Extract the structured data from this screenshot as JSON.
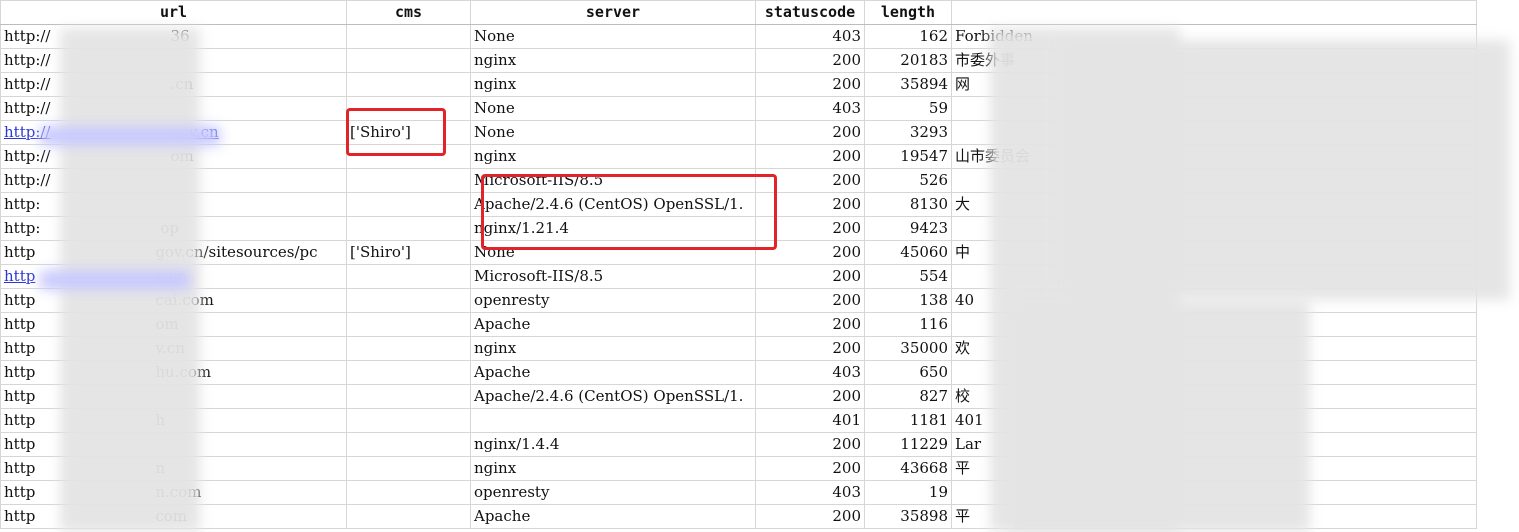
{
  "sheet": {
    "columns": [
      "url",
      "cms",
      "server",
      "statuscode",
      "length",
      ""
    ],
    "rows": [
      {
        "url": "http://",
        "url_tail": "36",
        "cms": "",
        "server": "None",
        "status": "403",
        "length": "162",
        "title": "Forbidden",
        "link": false
      },
      {
        "url": "http://",
        "url_tail": "",
        "cms": "",
        "server": "nginx",
        "status": "200",
        "length": "20183",
        "title": "市委外事",
        "link": false
      },
      {
        "url": "http://",
        "url_tail": ".cn",
        "cms": "",
        "server": "nginx",
        "status": "200",
        "length": "35894",
        "title": "网",
        "link": false
      },
      {
        "url": "http://",
        "url_tail": "",
        "cms": "",
        "server": "None",
        "status": "403",
        "length": "59",
        "title": "",
        "link": false
      },
      {
        "url": "http://",
        "url_tail": "gov.cn",
        "cms": "['Shiro']",
        "server": "None",
        "status": "200",
        "length": "3293",
        "title": "",
        "link": true
      },
      {
        "url": "http://",
        "url_tail": "om",
        "cms": "",
        "server": "nginx",
        "status": "200",
        "length": "19547",
        "title": "山市委员会",
        "link": false
      },
      {
        "url": "http://",
        "url_tail": "",
        "cms": "",
        "server": "Microsoft-IIS/8.5",
        "status": "200",
        "length": "526",
        "title": "",
        "link": false
      },
      {
        "url": "http:",
        "url_tail": "",
        "cms": "",
        "server": "Apache/2.4.6 (CentOS) OpenSSL/1.",
        "status": "200",
        "length": "8130",
        "title": "大",
        "link": false
      },
      {
        "url": "http:",
        "url_tail": "op",
        "cms": "",
        "server": "nginx/1.21.4",
        "status": "200",
        "length": "9423",
        "title": "",
        "link": false
      },
      {
        "url": "http",
        "url_tail": "gov.cn/sitesources/pc",
        "cms": "['Shiro']",
        "server": "None",
        "status": "200",
        "length": "45060",
        "title": "中",
        "link": false
      },
      {
        "url": "http",
        "url_tail": "com",
        "cms": "",
        "server": "Microsoft-IIS/8.5",
        "status": "200",
        "length": "554",
        "title": "",
        "link": true
      },
      {
        "url": "http",
        "url_tail": "cai.com",
        "cms": "",
        "server": "openresty",
        "status": "200",
        "length": "138",
        "title": "40",
        "link": false
      },
      {
        "url": "http",
        "url_tail": "om",
        "cms": "",
        "server": "Apache",
        "status": "200",
        "length": "116",
        "title": "",
        "link": false
      },
      {
        "url": "http",
        "url_tail": "v.cn",
        "cms": "",
        "server": "nginx",
        "status": "200",
        "length": "35000",
        "title": "欢",
        "link": false
      },
      {
        "url": "http",
        "url_tail": "hu.com",
        "cms": "",
        "server": "Apache",
        "status": "403",
        "length": "650",
        "title": "",
        "link": false
      },
      {
        "url": "http",
        "url_tail": "",
        "cms": "",
        "server": "Apache/2.4.6 (CentOS) OpenSSL/1.",
        "status": "200",
        "length": "827",
        "title": "校",
        "link": false
      },
      {
        "url": "http",
        "url_tail": "h",
        "cms": "",
        "server": "",
        "status": "401",
        "length": "1181",
        "title": "401",
        "link": false
      },
      {
        "url": "http",
        "url_tail": "",
        "cms": "",
        "server": "nginx/1.4.4",
        "status": "200",
        "length": "11229",
        "title": "Lar",
        "link": false
      },
      {
        "url": "http",
        "url_tail": "n",
        "cms": "",
        "server": "nginx",
        "status": "200",
        "length": "43668",
        "title": "平",
        "link": false
      },
      {
        "url": "http",
        "url_tail": "n.com",
        "cms": "",
        "server": "openresty",
        "status": "403",
        "length": "19",
        "title": "",
        "link": false
      },
      {
        "url": "http",
        "url_tail": "com",
        "cms": "",
        "server": "Apache",
        "status": "200",
        "length": "35898",
        "title": "平",
        "link": false
      }
    ]
  },
  "colors": {
    "highlight": "#e0242a",
    "link": "#2a37d6",
    "gridline": "#d6d6d6"
  }
}
